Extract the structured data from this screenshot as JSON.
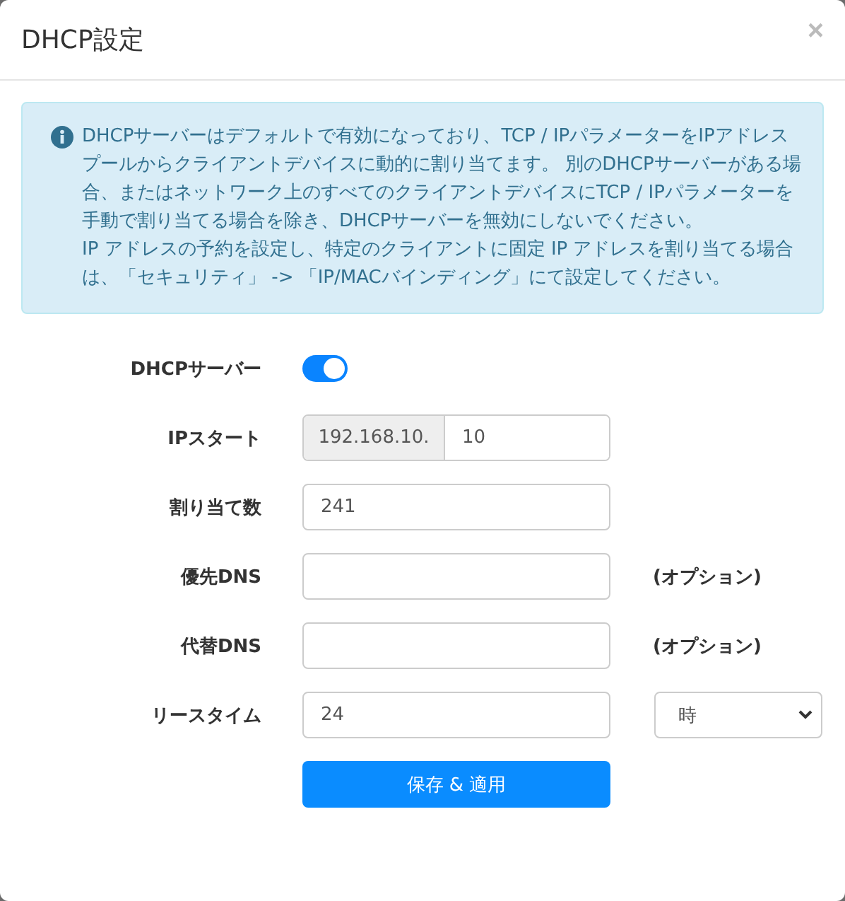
{
  "dialog": {
    "title": "DHCP設定",
    "close": "×"
  },
  "info": {
    "paragraphs": [
      "DHCPサーバーはデフォルトで有効になっており、TCP / IPパラメーターをIPアドレスプールからクライアントデバイスに動的に割り当てます。 別のDHCPサーバーがある場合、またはネットワーク上のすべてのクライアントデバイスにTCP / IPパラメーターを手動で割り当てる場合を除き、DHCPサーバーを無効にしないでください。",
      "IP アドレスの予約を設定し、特定のクライアントに固定 IP アドレスを割り当てる場合は、「セキュリティ」 -> 「IP/MACバインディング」にて設定してください。"
    ]
  },
  "fields": [
    {
      "kind": "toggle",
      "label": "DHCPサーバー",
      "on": true
    },
    {
      "kind": "prefixed",
      "label": "IPスタート",
      "prefix": "192.168.10.",
      "value": "10"
    },
    {
      "kind": "input",
      "label": "割り当て数",
      "value": "241"
    },
    {
      "kind": "input",
      "label": "優先DNS",
      "note": "(オプション)"
    },
    {
      "kind": "input",
      "label": "代替DNS",
      "note": "(オプション)"
    },
    {
      "kind": "select",
      "label": "リースタイム",
      "value": "24",
      "unit": "時"
    }
  ],
  "save_button": "保存 & 適用"
}
